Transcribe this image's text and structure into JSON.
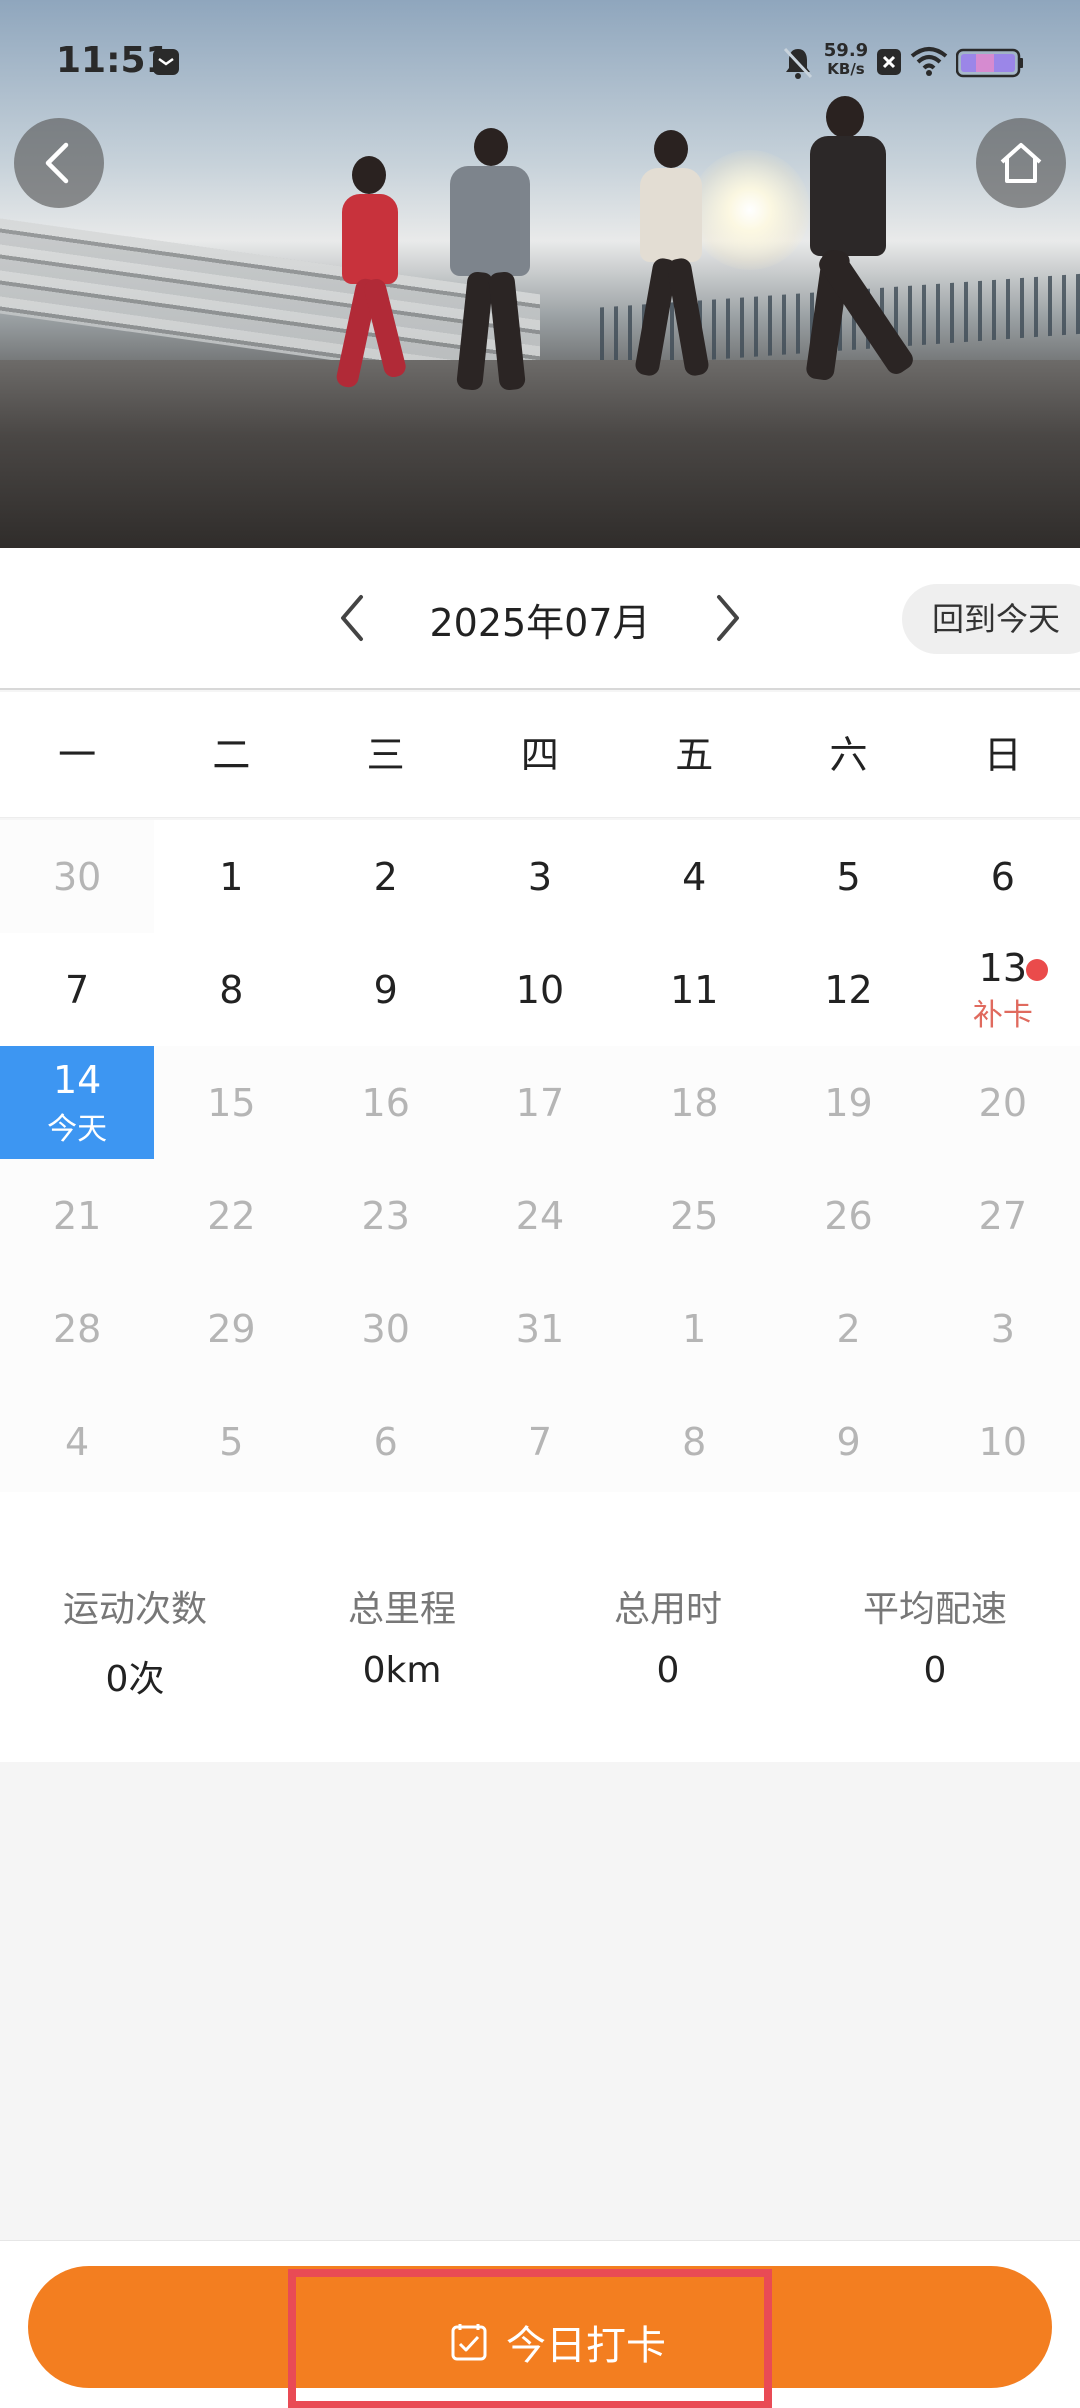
{
  "status_bar": {
    "time": "11:51",
    "net_speed_value": "59.9",
    "net_speed_unit": "KB/s",
    "icons": [
      "message-icon",
      "bell-off-icon",
      "close-box-icon",
      "wifi-icon",
      "battery-icon"
    ]
  },
  "hero": {
    "icons": {
      "back": "chevron-left-icon",
      "home": "home-icon"
    }
  },
  "calendar": {
    "month_title": "2025年07月",
    "today_button": "回到今天",
    "weekdays": [
      "一",
      "二",
      "三",
      "四",
      "五",
      "六",
      "日"
    ],
    "days": [
      {
        "n": "30"
      },
      {
        "n": "1"
      },
      {
        "n": "2"
      },
      {
        "n": "3"
      },
      {
        "n": "4"
      },
      {
        "n": "5"
      },
      {
        "n": "6"
      },
      {
        "n": "7"
      },
      {
        "n": "8"
      },
      {
        "n": "9"
      },
      {
        "n": "10"
      },
      {
        "n": "11"
      },
      {
        "n": "12"
      },
      {
        "n": "13",
        "sub": "补卡"
      },
      {
        "n": "14",
        "sub": "今天"
      },
      {
        "n": "15"
      },
      {
        "n": "16"
      },
      {
        "n": "17"
      },
      {
        "n": "18"
      },
      {
        "n": "19"
      },
      {
        "n": "20"
      },
      {
        "n": "21"
      },
      {
        "n": "22"
      },
      {
        "n": "23"
      },
      {
        "n": "24"
      },
      {
        "n": "25"
      },
      {
        "n": "26"
      },
      {
        "n": "27"
      },
      {
        "n": "28"
      },
      {
        "n": "29"
      },
      {
        "n": "30"
      },
      {
        "n": "31"
      },
      {
        "n": "1"
      },
      {
        "n": "2"
      },
      {
        "n": "3"
      },
      {
        "n": "4"
      },
      {
        "n": "5"
      },
      {
        "n": "6"
      },
      {
        "n": "7"
      },
      {
        "n": "8"
      },
      {
        "n": "9"
      },
      {
        "n": "10"
      }
    ]
  },
  "stats": {
    "count_label": "运动次数",
    "count_value": "0次",
    "distance_label": "总里程",
    "distance_value": "0km",
    "duration_label": "总用时",
    "duration_value": "0",
    "pace_label": "平均配速",
    "pace_value": "0"
  },
  "bottom": {
    "checkin_label": "今日打卡",
    "icon": "checkbox-icon"
  },
  "colors": {
    "accent_orange": "#f37e20",
    "today_blue": "#3d96f2",
    "makeup_red": "#e06a5e",
    "highlight_red": "#e94b55"
  }
}
